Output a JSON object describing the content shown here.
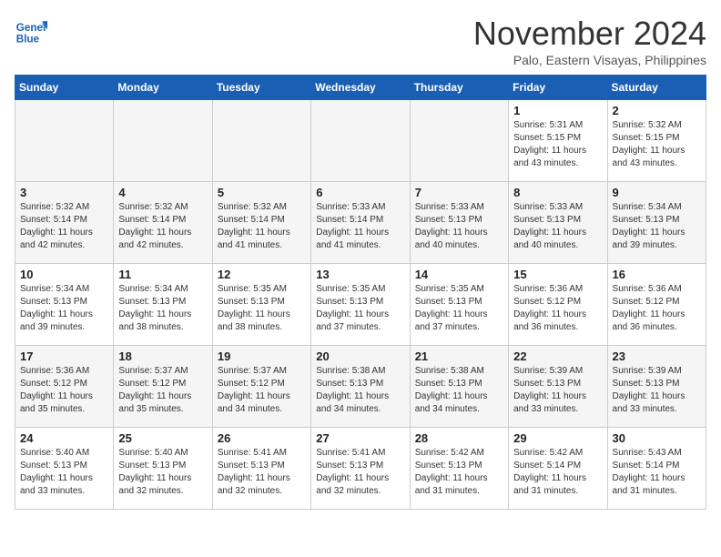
{
  "header": {
    "logo_line1": "General",
    "logo_line2": "Blue",
    "month": "November 2024",
    "location": "Palo, Eastern Visayas, Philippines"
  },
  "days_of_week": [
    "Sunday",
    "Monday",
    "Tuesday",
    "Wednesday",
    "Thursday",
    "Friday",
    "Saturday"
  ],
  "weeks": [
    [
      {
        "day": "",
        "info": "",
        "empty": true
      },
      {
        "day": "",
        "info": "",
        "empty": true
      },
      {
        "day": "",
        "info": "",
        "empty": true
      },
      {
        "day": "",
        "info": "",
        "empty": true
      },
      {
        "day": "",
        "info": "",
        "empty": true
      },
      {
        "day": "1",
        "info": "Sunrise: 5:31 AM\nSunset: 5:15 PM\nDaylight: 11 hours\nand 43 minutes."
      },
      {
        "day": "2",
        "info": "Sunrise: 5:32 AM\nSunset: 5:15 PM\nDaylight: 11 hours\nand 43 minutes."
      }
    ],
    [
      {
        "day": "3",
        "info": "Sunrise: 5:32 AM\nSunset: 5:14 PM\nDaylight: 11 hours\nand 42 minutes."
      },
      {
        "day": "4",
        "info": "Sunrise: 5:32 AM\nSunset: 5:14 PM\nDaylight: 11 hours\nand 42 minutes."
      },
      {
        "day": "5",
        "info": "Sunrise: 5:32 AM\nSunset: 5:14 PM\nDaylight: 11 hours\nand 41 minutes."
      },
      {
        "day": "6",
        "info": "Sunrise: 5:33 AM\nSunset: 5:14 PM\nDaylight: 11 hours\nand 41 minutes."
      },
      {
        "day": "7",
        "info": "Sunrise: 5:33 AM\nSunset: 5:13 PM\nDaylight: 11 hours\nand 40 minutes."
      },
      {
        "day": "8",
        "info": "Sunrise: 5:33 AM\nSunset: 5:13 PM\nDaylight: 11 hours\nand 40 minutes."
      },
      {
        "day": "9",
        "info": "Sunrise: 5:34 AM\nSunset: 5:13 PM\nDaylight: 11 hours\nand 39 minutes."
      }
    ],
    [
      {
        "day": "10",
        "info": "Sunrise: 5:34 AM\nSunset: 5:13 PM\nDaylight: 11 hours\nand 39 minutes."
      },
      {
        "day": "11",
        "info": "Sunrise: 5:34 AM\nSunset: 5:13 PM\nDaylight: 11 hours\nand 38 minutes."
      },
      {
        "day": "12",
        "info": "Sunrise: 5:35 AM\nSunset: 5:13 PM\nDaylight: 11 hours\nand 38 minutes."
      },
      {
        "day": "13",
        "info": "Sunrise: 5:35 AM\nSunset: 5:13 PM\nDaylight: 11 hours\nand 37 minutes."
      },
      {
        "day": "14",
        "info": "Sunrise: 5:35 AM\nSunset: 5:13 PM\nDaylight: 11 hours\nand 37 minutes."
      },
      {
        "day": "15",
        "info": "Sunrise: 5:36 AM\nSunset: 5:12 PM\nDaylight: 11 hours\nand 36 minutes."
      },
      {
        "day": "16",
        "info": "Sunrise: 5:36 AM\nSunset: 5:12 PM\nDaylight: 11 hours\nand 36 minutes."
      }
    ],
    [
      {
        "day": "17",
        "info": "Sunrise: 5:36 AM\nSunset: 5:12 PM\nDaylight: 11 hours\nand 35 minutes."
      },
      {
        "day": "18",
        "info": "Sunrise: 5:37 AM\nSunset: 5:12 PM\nDaylight: 11 hours\nand 35 minutes."
      },
      {
        "day": "19",
        "info": "Sunrise: 5:37 AM\nSunset: 5:12 PM\nDaylight: 11 hours\nand 34 minutes."
      },
      {
        "day": "20",
        "info": "Sunrise: 5:38 AM\nSunset: 5:13 PM\nDaylight: 11 hours\nand 34 minutes."
      },
      {
        "day": "21",
        "info": "Sunrise: 5:38 AM\nSunset: 5:13 PM\nDaylight: 11 hours\nand 34 minutes."
      },
      {
        "day": "22",
        "info": "Sunrise: 5:39 AM\nSunset: 5:13 PM\nDaylight: 11 hours\nand 33 minutes."
      },
      {
        "day": "23",
        "info": "Sunrise: 5:39 AM\nSunset: 5:13 PM\nDaylight: 11 hours\nand 33 minutes."
      }
    ],
    [
      {
        "day": "24",
        "info": "Sunrise: 5:40 AM\nSunset: 5:13 PM\nDaylight: 11 hours\nand 33 minutes."
      },
      {
        "day": "25",
        "info": "Sunrise: 5:40 AM\nSunset: 5:13 PM\nDaylight: 11 hours\nand 32 minutes."
      },
      {
        "day": "26",
        "info": "Sunrise: 5:41 AM\nSunset: 5:13 PM\nDaylight: 11 hours\nand 32 minutes."
      },
      {
        "day": "27",
        "info": "Sunrise: 5:41 AM\nSunset: 5:13 PM\nDaylight: 11 hours\nand 32 minutes."
      },
      {
        "day": "28",
        "info": "Sunrise: 5:42 AM\nSunset: 5:13 PM\nDaylight: 11 hours\nand 31 minutes."
      },
      {
        "day": "29",
        "info": "Sunrise: 5:42 AM\nSunset: 5:14 PM\nDaylight: 11 hours\nand 31 minutes."
      },
      {
        "day": "30",
        "info": "Sunrise: 5:43 AM\nSunset: 5:14 PM\nDaylight: 11 hours\nand 31 minutes."
      }
    ]
  ]
}
